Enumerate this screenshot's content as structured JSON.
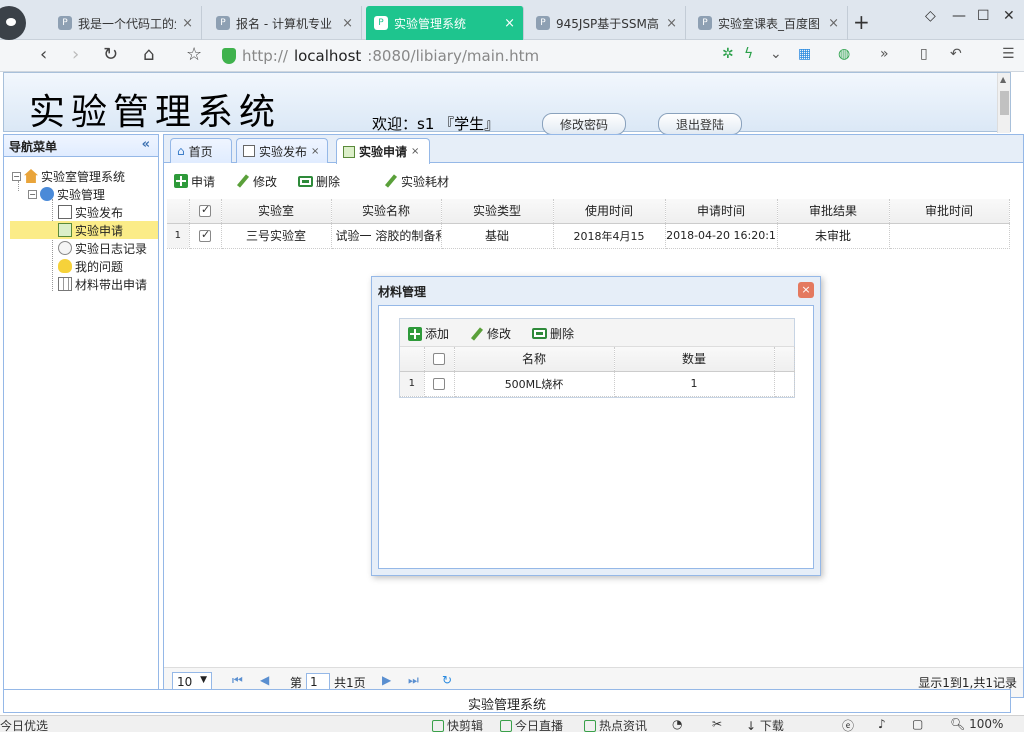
{
  "browser": {
    "tabs": [
      {
        "label": "我是一个代码工的生",
        "active": false
      },
      {
        "label": "报名 - 计算机专业",
        "active": false
      },
      {
        "label": "实验管理系统",
        "active": true
      },
      {
        "label": "945JSP基于SSM高",
        "active": false
      },
      {
        "label": "实验室课表_百度图",
        "active": false
      }
    ],
    "new_tab": "+",
    "url_prefix": "http://",
    "url_host": "localhost",
    "url_rest": ":8080/libiary/main.htm"
  },
  "header": {
    "system_name": "实验管理系统",
    "welcome": "欢迎：s1 『学生』",
    "change_password": "修改密码",
    "logout": "退出登陆"
  },
  "sidebar": {
    "title": "导航菜单",
    "collapse": "«",
    "tree": {
      "root": "实验室管理系统",
      "group": "实验管理",
      "items": [
        "实验发布",
        "实验申请",
        "实验日志记录",
        "我的问题",
        "材料带出申请"
      ],
      "selected_index": 1
    }
  },
  "tabs": [
    {
      "label": "首页",
      "closable": false
    },
    {
      "label": "实验发布",
      "closable": true
    },
    {
      "label": "实验申请",
      "closable": true,
      "active": true
    }
  ],
  "toolbar": {
    "apply": "申请",
    "edit": "修改",
    "delete": "删除",
    "materials": "实验耗材"
  },
  "grid": {
    "columns": [
      "实验室",
      "实验名称",
      "实验类型",
      "使用时间",
      "申请时间",
      "审批结果",
      "审批时间"
    ],
    "rows": [
      {
        "num": "1",
        "checked": true,
        "cells": [
          "三号实验室",
          "试验一 溶胶的制备和",
          "基础",
          "2018年4月15",
          "2018-04-20 16:20:1",
          "未审批",
          ""
        ]
      }
    ]
  },
  "pager": {
    "page_size": "10",
    "page_prefix": "第",
    "page": "1",
    "page_suffix": "共1页",
    "summary": "显示1到1,共1记录"
  },
  "footer": "实验管理系统",
  "dialog": {
    "title": "材料管理",
    "close": "×",
    "toolbar": {
      "add": "添加",
      "edit": "修改",
      "delete": "删除"
    },
    "columns": [
      "名称",
      "数量"
    ],
    "rows": [
      {
        "num": "1",
        "checked": false,
        "cells": [
          "500ML烧杯",
          "1"
        ]
      }
    ]
  },
  "statusbar": {
    "left": "今日优选",
    "items": [
      "快剪辑",
      "今日直播",
      "热点资讯"
    ],
    "download": "下载",
    "zoom": "100%"
  }
}
